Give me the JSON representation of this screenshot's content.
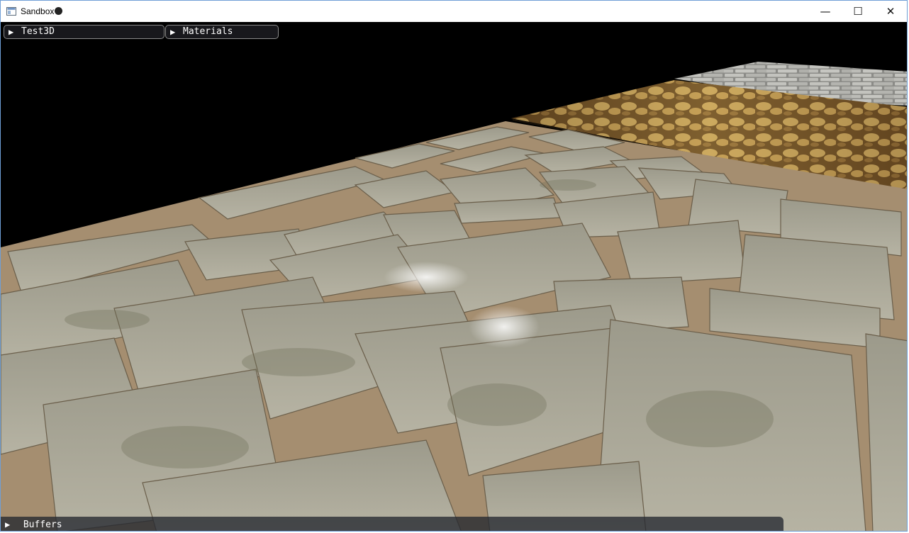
{
  "window": {
    "title": "Sandbox",
    "controls": {
      "minimize": "—",
      "maximize": "☐",
      "close": "✕"
    }
  },
  "panels": {
    "test3d": {
      "label": "Test3D",
      "arrow": "▶"
    },
    "materials": {
      "label": "Materials",
      "arrow": "▶"
    },
    "buffers": {
      "label": "Buffers",
      "arrow": "▶"
    }
  },
  "colors": {
    "stone_light": "#b9b7a6",
    "stone_mid": "#8e8c7d",
    "stone_dark": "#5f5d52",
    "mortar": "#a18b6e",
    "sand_light": "#d8b86a",
    "sand_dark": "#4b351a",
    "grey_bricks": "#a7a7a2"
  }
}
